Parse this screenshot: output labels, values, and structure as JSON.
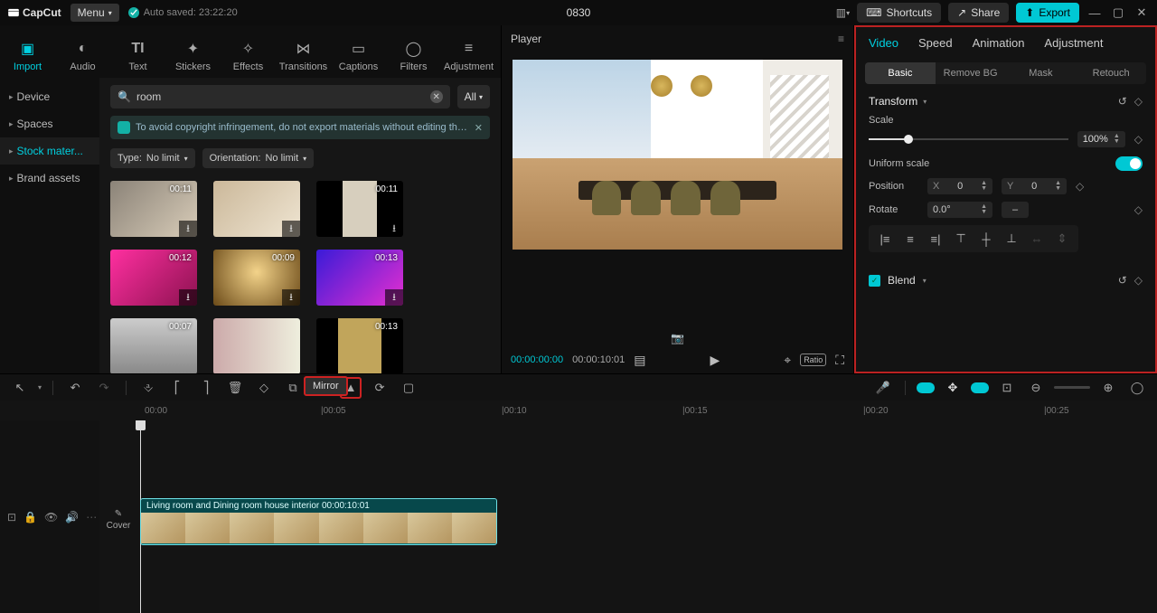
{
  "topbar": {
    "app": "CapCut",
    "menu": "Menu",
    "autosave": "Auto saved: 23:22:20",
    "title": "0830",
    "shortcuts": "Shortcuts",
    "share": "Share",
    "export": "Export"
  },
  "tool_tabs": [
    "Import",
    "Audio",
    "Text",
    "Stickers",
    "Effects",
    "Transitions",
    "Captions",
    "Filters",
    "Adjustment"
  ],
  "nav_items": [
    "Device",
    "Spaces",
    "Stock mater...",
    "Brand assets"
  ],
  "search": {
    "query": "room",
    "all": "All"
  },
  "notice": "To avoid copyright infringement, do not export materials without editing them on Ca",
  "filters": {
    "type_lbl": "Type:",
    "type_val": "No limit",
    "orient_lbl": "Orientation:",
    "orient_val": "No limit"
  },
  "thumbs": [
    "00:11",
    "",
    "00:11",
    "00:12",
    "00:09",
    "00:13",
    "00:07",
    "",
    "00:13"
  ],
  "player": {
    "label": "Player",
    "t1": "00:00:00:00",
    "t2": "00:00:10:01",
    "ratio": "Ratio"
  },
  "inspector": {
    "tabs": [
      "Video",
      "Speed",
      "Animation",
      "Adjustment"
    ],
    "subtabs": [
      "Basic",
      "Remove BG",
      "Mask",
      "Retouch"
    ],
    "transform": "Transform",
    "scale_lbl": "Scale",
    "scale_val": "100%",
    "uniform": "Uniform scale",
    "position": "Position",
    "px": "0",
    "py": "0",
    "pxl": "X",
    "pyl": "Y",
    "rotate": "Rotate",
    "rotate_val": "0.0°",
    "blend": "Blend"
  },
  "tooltip": "Mirror",
  "ruler": [
    "00:00",
    "|00:05",
    "|00:10",
    "|00:15",
    "|00:20",
    "|00:25"
  ],
  "clip": {
    "title": "Living room and Dining room house interior  00:00:10:01"
  },
  "cover": "Cover"
}
